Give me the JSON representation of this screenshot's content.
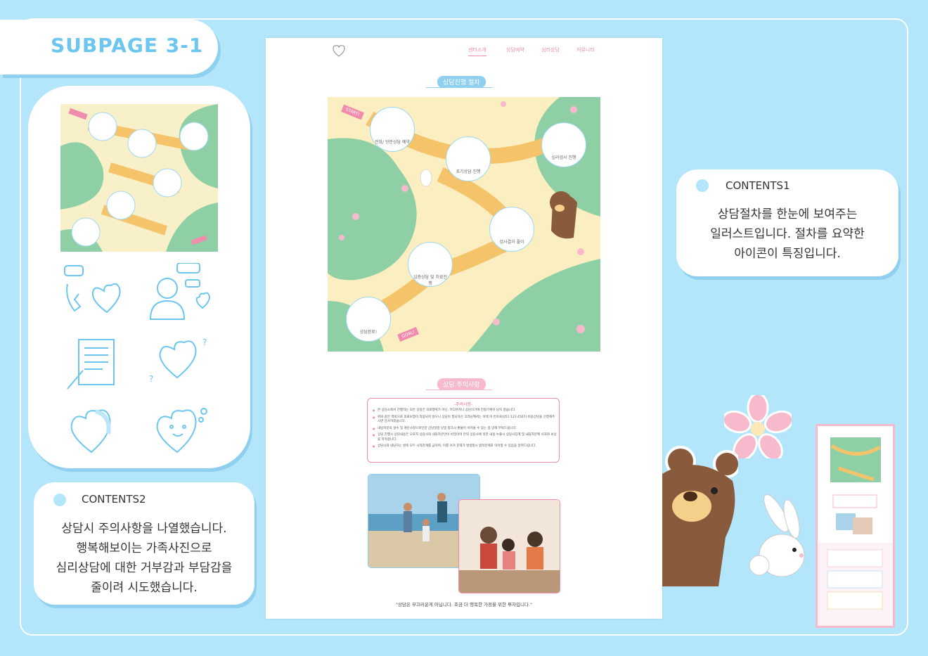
{
  "page": {
    "title": "SUBPAGE 3-1"
  },
  "contents1": {
    "heading": "CONTENTS1",
    "lines": [
      "상담절차를 한눈에 보여주는",
      "일러스트입니다. 절차를 요약한",
      "아이콘이 특징입니다."
    ]
  },
  "contents2": {
    "heading": "CONTENTS2",
    "lines": [
      "상담시 주의사항을 나열했습니다.",
      "행복해보이는 가족사진으로",
      "심리상담에 대한 거부감과 부담감을",
      "줄이려 시도했습니다."
    ]
  },
  "mockup": {
    "nav": [
      "센터소개",
      "상담예약",
      "심리상담",
      "커뮤니티"
    ],
    "process_title": "상담진행 절차",
    "start_label": "START!",
    "goal_label": "GOAL!",
    "steps": [
      "전화/ 방문상담 예약",
      "초기상담 진행",
      "심리검사 진행",
      "검사결과 풀이",
      "심층상담 및 치료진행",
      "상담완료!"
    ],
    "caution_title": "상담 주의사항",
    "notes_title": "-주의사항-",
    "notes": [
      "본 상담소에서 진행하는 모든 상담은 의료행위가 아닌, 어디까지나 상담이기에 진찰기록이 남지 않습니다.",
      "위와 같은 맥락으로 의료보험이 적용되지 않으니 상담이 필요하신 고객님께서는 아래 이 번호로(051 123 4567) 비용상담을 신청해주시면 감사하겠습니다.",
      "내담자분의 실수 및 개인사정으로인한 상담일정 당일 펑크시 환불이 어려울 수 있는 점 양해 부탁드립니다.",
      "상담 진행시 상담내용은 오로지 상담사와 내담자분만이 비밀이며 만약 상담사에 의한 내용 누출시 상담사징계 및 내담자분께 사과와 보상을 약속합니다.",
      "상담시와 내담자는 쌍축 모두 사적관계를 금하며, 이를 어겨 문제가 발생할시 법적문제로 이어질 수 있음을 알려드립니다."
    ],
    "quote": "\"상담은 부끄러운게 아닙니다. 조금 더 행복한 가정을 위한 투자입니다.\""
  },
  "colors": {
    "background": "#b3e5fb",
    "accent_blue": "#6cc6ef",
    "accent_pink": "#f08cad",
    "green": "#8fcfa6",
    "cream": "#fbeec0"
  }
}
